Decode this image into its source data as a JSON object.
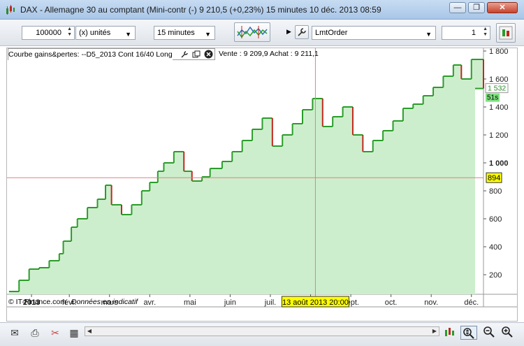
{
  "window": {
    "title": "DAX - Allemagne 30 au comptant (Mini-contr (-)    9 210,5 (+0,23%)     15 minutes  10 déc. 2013 08:59",
    "minimize_label": "—",
    "maximize_label": "❐",
    "close_label": "✕"
  },
  "toolbar": {
    "quantity_value": "100000",
    "unit_value": "(x) unités",
    "timeframe_value": "15 minutes",
    "order_type_value": "LmtOrder",
    "lots_value": "1"
  },
  "legend": {
    "title": "Courbe gains&pertes: --D5_2013 Cont 16/40 Long",
    "quote": "Vente : 9 209,9 Achat : 9 211,1"
  },
  "footer": {
    "copyright": "© IT-Finance.com",
    "disclaimer": "Données en indicatif"
  },
  "price_labels": {
    "current_value": "1 532",
    "countdown": "51s",
    "crosshair_value": "894",
    "crosshair_date": "13 août 2013 20:00"
  },
  "colors": {
    "area_fill": "#cdeecd",
    "up_line": "#2a9d2a",
    "down_line": "#c0281e",
    "crosshair": "#e08080",
    "highlight_label": "#ffff00",
    "current_label_bg": "#7fe07f"
  },
  "chart_data": {
    "type": "area",
    "title": "",
    "xlabel": "",
    "ylabel": "",
    "ylim": [
      60,
      1820
    ],
    "yticks": [
      200,
      400,
      600,
      800,
      1000,
      1200,
      1400,
      1600,
      1800
    ],
    "ytick_labels": [
      "200",
      "400",
      "600",
      "800",
      "1 000",
      "1 200",
      "1 400",
      "1 600",
      "1 800"
    ],
    "xtick_labels": [
      "2013",
      "févr.",
      "mars",
      "avr.",
      "mai",
      "juin",
      "juil.",
      "août",
      "sept.",
      "oct.",
      "nov.",
      "déc."
    ],
    "xtick_positions": [
      0.06,
      1.0,
      2.0,
      3.0,
      4.0,
      5.0,
      6.0,
      7.0,
      8.0,
      9.0,
      10.0,
      11.0
    ],
    "xlim": [
      -0.55,
      11.3
    ],
    "series": [
      {
        "values_x": [
          -0.5,
          -0.25,
          0.0,
          0.25,
          0.5,
          0.75,
          0.85,
          1.05,
          1.2,
          1.45,
          1.7,
          1.9,
          2.05,
          2.3,
          2.55,
          2.8,
          3.0,
          3.2,
          3.35,
          3.6,
          3.85,
          4.05,
          4.3,
          4.5,
          4.8,
          5.05,
          5.3,
          5.55,
          5.8,
          6.05,
          6.3,
          6.55,
          6.8,
          7.05,
          7.3,
          7.55,
          7.8,
          8.05,
          8.3,
          8.55,
          8.8,
          9.05,
          9.3,
          9.55,
          9.8,
          10.05,
          10.3,
          10.55,
          10.75,
          11.0,
          11.3
        ],
        "values_y": [
          80,
          160,
          240,
          250,
          300,
          350,
          440,
          540,
          600,
          680,
          740,
          840,
          700,
          630,
          700,
          800,
          860,
          940,
          1000,
          1080,
          940,
          870,
          900,
          960,
          1010,
          1080,
          1160,
          1240,
          1320,
          1120,
          1200,
          1280,
          1380,
          1460,
          1260,
          1330,
          1400,
          1200,
          1080,
          1160,
          1230,
          1300,
          1390,
          1420,
          1480,
          1540,
          1620,
          1700,
          1600,
          1740,
          1532
        ]
      }
    ],
    "crosshair": {
      "x": 7.12,
      "y": 894
    }
  }
}
